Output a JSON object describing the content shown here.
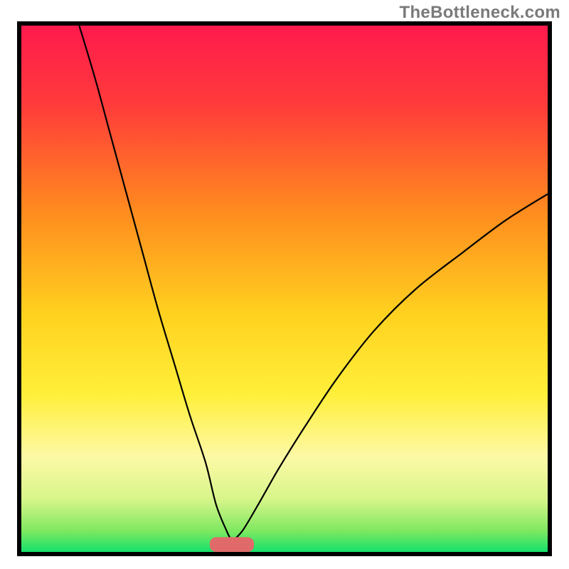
{
  "watermark": "TheBottleneck.com",
  "chart_data": {
    "type": "line",
    "title": "",
    "xlabel": "",
    "ylabel": "",
    "xlim": [
      0,
      100
    ],
    "ylim": [
      0,
      100
    ],
    "gradient_stops": [
      {
        "offset": 0.0,
        "color": "#ff1a4d"
      },
      {
        "offset": 0.15,
        "color": "#ff3b3b"
      },
      {
        "offset": 0.35,
        "color": "#ff8a1f"
      },
      {
        "offset": 0.55,
        "color": "#ffd21f"
      },
      {
        "offset": 0.7,
        "color": "#ffef3a"
      },
      {
        "offset": 0.82,
        "color": "#fdf9a6"
      },
      {
        "offset": 0.9,
        "color": "#d7f58a"
      },
      {
        "offset": 0.96,
        "color": "#7ee860"
      },
      {
        "offset": 1.0,
        "color": "#14e06a"
      }
    ],
    "curve_min_x": 40,
    "curve_min_y": 2,
    "series": [
      {
        "name": "left-branch",
        "x": [
          11,
          14,
          17,
          20,
          23,
          26,
          29,
          32,
          35,
          37,
          39,
          40
        ],
        "y": [
          100,
          90,
          79,
          68,
          57,
          46,
          36,
          26,
          17,
          9,
          4,
          2
        ]
      },
      {
        "name": "right-branch",
        "x": [
          40,
          42,
          45,
          49,
          54,
          60,
          67,
          75,
          84,
          92,
          100
        ],
        "y": [
          2,
          4,
          9,
          16,
          24,
          33,
          42,
          50,
          57,
          63,
          68
        ]
      }
    ],
    "marker": {
      "x": 40,
      "y": 1.4,
      "rx": 4.2,
      "ry": 1.4,
      "fill": "#e06a6a"
    }
  }
}
